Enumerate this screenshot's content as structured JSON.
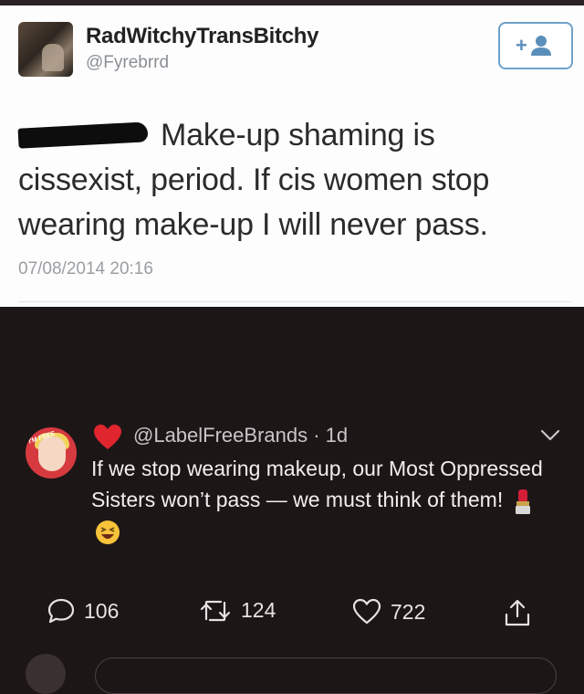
{
  "tweet": {
    "display_name": "RadWitchyTransBitchy",
    "handle": "@Fyrebrrd",
    "text": "Make-up shaming is cissexist, period. If cis women stop wearing make-up I will never pass.",
    "timestamp": "07/08/2014 20:16"
  },
  "reply": {
    "handle_time": "@LabelFreeBrands · 1d",
    "text": "If we stop wearing makeup, our Most Oppressed Sisters won’t pass — we must think of them!",
    "avatar_badge": "I'M FREE"
  },
  "actions": {
    "comments": "106",
    "retweets": "124",
    "likes": "722"
  },
  "colors": {
    "dark_bg": "#1d1617",
    "light_bg": "#fdfdfd",
    "heart": "#e0252f",
    "follow_blue": "#5b8fbb"
  },
  "icons": [
    "user-icon",
    "follow-icon",
    "heart-icon",
    "chevron-down-icon",
    "lipstick-icon",
    "laughing-emoji-icon",
    "comment-icon",
    "retweet-icon",
    "like-icon",
    "share-icon"
  ]
}
